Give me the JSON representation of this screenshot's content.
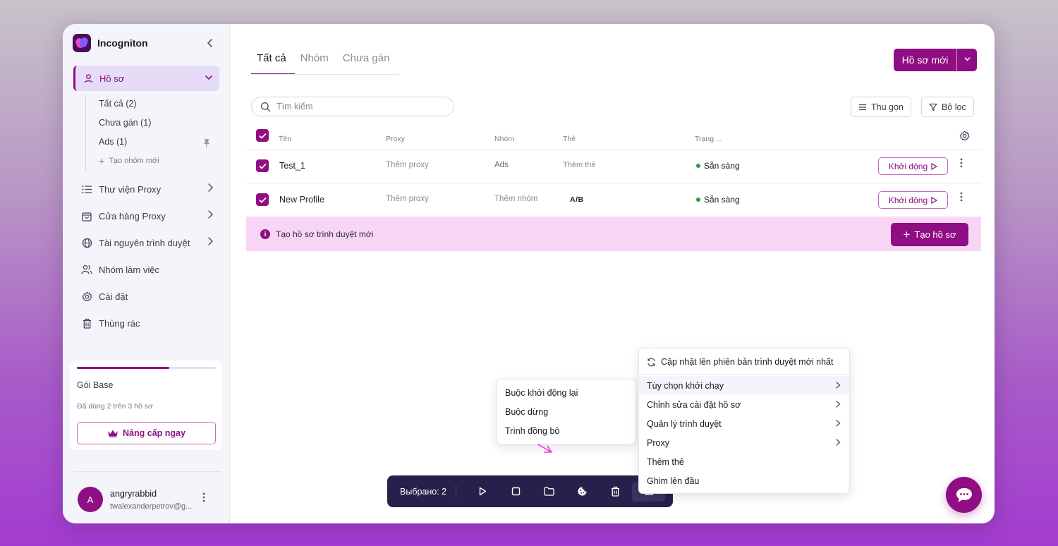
{
  "app": {
    "name": "Incogniton"
  },
  "sidebar": {
    "profiles_label": "Hồ sơ",
    "sub_items": [
      {
        "label": "Tất cả (2)"
      },
      {
        "label": "Chưa gán (1)"
      },
      {
        "label": "Ads (1)"
      }
    ],
    "new_group_label": "Tạo nhóm mới",
    "items": [
      {
        "label": "Thư viện Proxy",
        "icon": "list-icon"
      },
      {
        "label": "Cửa hàng Proxy",
        "icon": "shopping-bag-icon"
      },
      {
        "label": "Tài nguyên trình duyệt",
        "icon": "globe-icon"
      },
      {
        "label": "Nhóm làm việc",
        "icon": "users-icon"
      },
      {
        "label": "Cài đặt",
        "icon": "gear-icon"
      },
      {
        "label": "Thùng rác",
        "icon": "trash-icon"
      }
    ],
    "plan": {
      "name": "Gói Base",
      "usage": "Đã dùng 2 trên 3 hồ sơ",
      "usage_fraction": 0.667,
      "upgrade_label": "Nâng cấp ngay"
    },
    "user": {
      "initial": "A",
      "name": "angryrabbid",
      "email": "twalexanderpetrov@g..."
    }
  },
  "main": {
    "tabs": [
      {
        "label": "Tất cả",
        "active": true
      },
      {
        "label": "Nhóm",
        "active": false
      },
      {
        "label": "Chưa gán",
        "active": false
      }
    ],
    "new_profile_label": "Hồ sơ mới",
    "search_placeholder": "Tìm kiếm",
    "collapse_label": "Thu gọn",
    "filter_label": "Bộ lọc",
    "columns": [
      "Tên",
      "Proxy",
      "Nhóm",
      "Thẻ",
      "Trạng ..."
    ],
    "rows": [
      {
        "name": "Test_1",
        "proxy": "Thêm proxy",
        "group": "Ads",
        "tag": "Thêm thẻ",
        "status": "Sẵn sàng",
        "action": "Khởi động"
      },
      {
        "name": "New Profile",
        "proxy": "Thêm proxy",
        "group": "Thêm nhóm",
        "tag": "A/B",
        "status": "Sẵn sàng",
        "action": "Khởi động"
      }
    ],
    "banner": {
      "text": "Tạo hồ sơ trình duyệt mới",
      "button": "Tạo hồ sơ"
    }
  },
  "bulk_bar": {
    "selected_label": "Выбрано: 2"
  },
  "context_menu": {
    "items": [
      {
        "label": "Cập nhật lên phiên bản trình duyệt mới nhất"
      },
      {
        "label": "Tùy chọn khởi chạy"
      },
      {
        "label": "Chỉnh sửa cài đặt hồ sơ"
      },
      {
        "label": "Quản lý trình duyệt"
      },
      {
        "label": "Proxy"
      },
      {
        "label": "Thêm thẻ"
      },
      {
        "label": "Ghim lên đầu"
      }
    ]
  },
  "submenu": {
    "items": [
      {
        "label": "Buộc khởi động lại"
      },
      {
        "label": "Buộc dừng"
      },
      {
        "label": "Trình đồng bộ"
      }
    ]
  },
  "colors": {
    "accent": "#8f0e83",
    "toolbar_bg": "#26204a",
    "status_ready": "#2e9c3c",
    "banner_bg": "#f9d5f5",
    "pointer_arrow": "#f53fe0"
  }
}
